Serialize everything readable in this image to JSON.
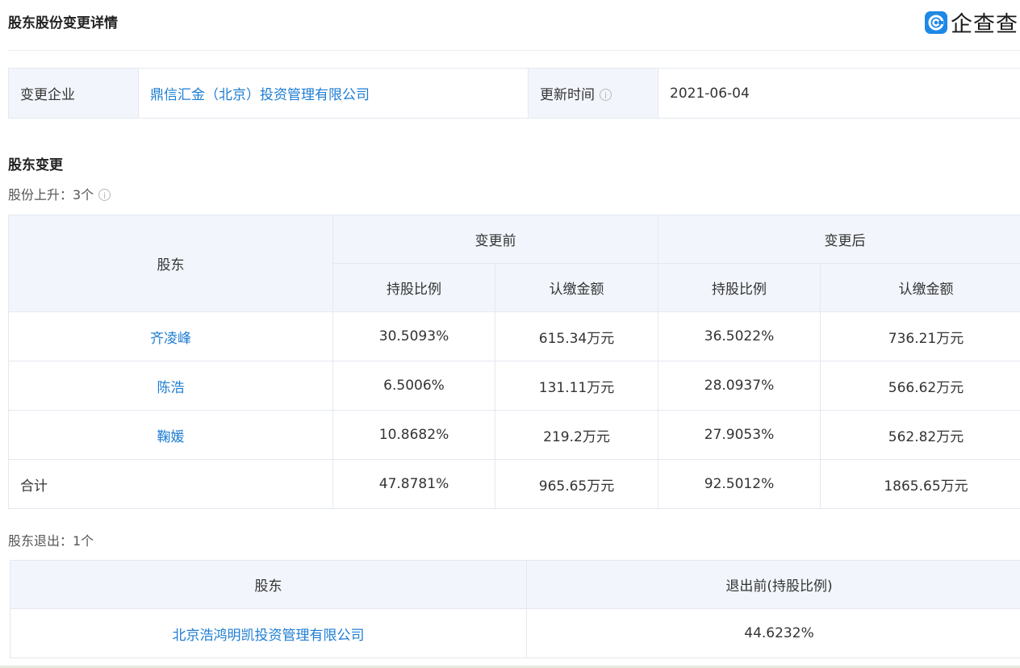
{
  "page": {
    "title": "股东股份变更详情",
    "logo_text": "企查查",
    "logo_icon_glyph": "C"
  },
  "info": {
    "company_label": "变更企业",
    "company_name": "鼎信汇金（北京）投资管理有限公司",
    "update_label": "更新时间",
    "info_icon_glyph": "i",
    "update_time": "2021-06-04"
  },
  "shareholder_change": {
    "section_title": "股东变更",
    "increase_label": "股份上升：3个",
    "info_icon_glyph": "i",
    "headers": {
      "shareholder": "股东",
      "before": "变更前",
      "after": "变更后",
      "ratio": "持股比例",
      "amount": "认缴金额"
    },
    "rows": [
      {
        "name": "齐凌峰",
        "before_ratio": "30.5093%",
        "before_amount": "615.34万元",
        "after_ratio": "36.5022%",
        "after_amount": "736.21万元"
      },
      {
        "name": "陈浩",
        "before_ratio": "6.5006%",
        "before_amount": "131.11万元",
        "after_ratio": "28.0937%",
        "after_amount": "566.62万元"
      },
      {
        "name": "鞠媛",
        "before_ratio": "10.8682%",
        "before_amount": "219.2万元",
        "after_ratio": "27.9053%",
        "after_amount": "562.82万元"
      }
    ],
    "total": {
      "label": "合计",
      "before_ratio": "47.8781%",
      "before_amount": "965.65万元",
      "after_ratio": "92.5012%",
      "after_amount": "1865.65万元"
    }
  },
  "shareholder_exit": {
    "exit_label": "股东退出：1个",
    "headers": {
      "shareholder": "股东",
      "before_exit": "退出前(持股比例)"
    },
    "rows": [
      {
        "name": "北京浩鸿明凯投资管理有限公司",
        "ratio": "44.6232%"
      }
    ]
  },
  "colors": {
    "link": "#1e7dd3",
    "header_bg": "#f2f6fc",
    "border": "#e4e8ef",
    "logo_blue": "#1e88e5"
  }
}
